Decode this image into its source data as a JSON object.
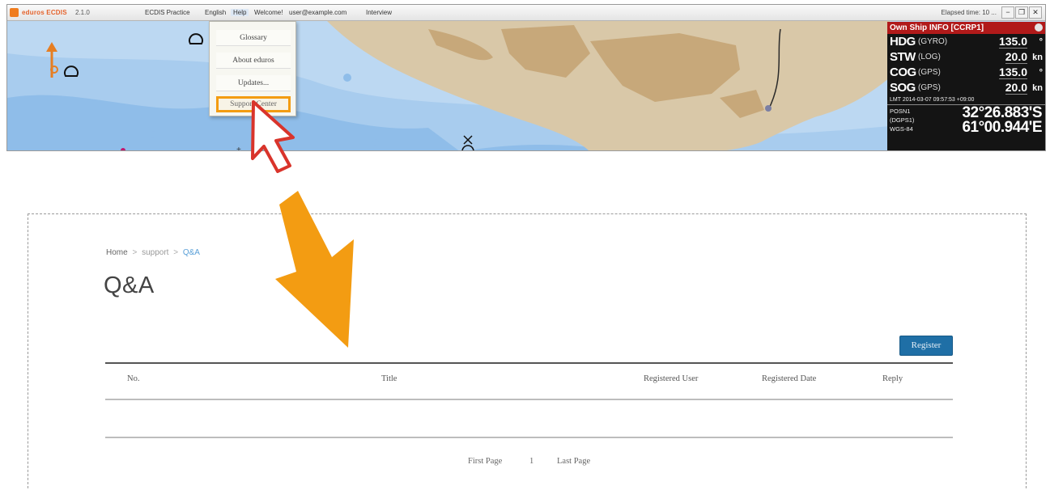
{
  "ecdis": {
    "app_name": "eduros ECDIS",
    "version": "2.1.0",
    "menu": [
      "ECDIS Practice",
      "English",
      "Help",
      "Welcome!",
      "user@example.com",
      "Interview"
    ],
    "elapsed_label": "Elapsed time: 10 ...",
    "window_buttons": [
      "−",
      "❐",
      "✕"
    ],
    "help_dropdown": [
      "Glossary",
      "About eduros",
      "Updates...",
      "Support Center"
    ],
    "own_ship": {
      "header": "Own Ship INFO [CCRP1]",
      "rows": [
        {
          "key": "HDG",
          "src": "(GYRO)",
          "value": "135.0",
          "unit": "°"
        },
        {
          "key": "STW",
          "src": "(LOG)",
          "value": "20.0",
          "unit": "kn"
        },
        {
          "key": "COG",
          "src": "(GPS)",
          "value": "135.0",
          "unit": "°"
        },
        {
          "key": "SOG",
          "src": "(GPS)",
          "value": "20.0",
          "unit": "kn"
        }
      ],
      "lmt": "LMT 2014-03-07 09:57:53 +09:00",
      "posn_labels": [
        "POSN1",
        "(DGPS1)",
        "WGS-84"
      ],
      "lat": "32°26.883'S",
      "lon": "61°00.944'E"
    }
  },
  "page": {
    "breadcrumb": {
      "home": "Home",
      "sep": ">",
      "support": "support",
      "current": "Q&A"
    },
    "title": "Q&A",
    "register_button": "Register",
    "columns": [
      "No.",
      "Title",
      "Registered User",
      "Registered Date",
      "Reply"
    ],
    "pager": {
      "first": "First Page",
      "current": "1",
      "last": "Last Page"
    }
  },
  "colors": {
    "accent_orange": "#f39c12",
    "cursor_red": "#d9342b",
    "button_blue": "#1f6fa6",
    "panel_red": "#b11a1a"
  }
}
